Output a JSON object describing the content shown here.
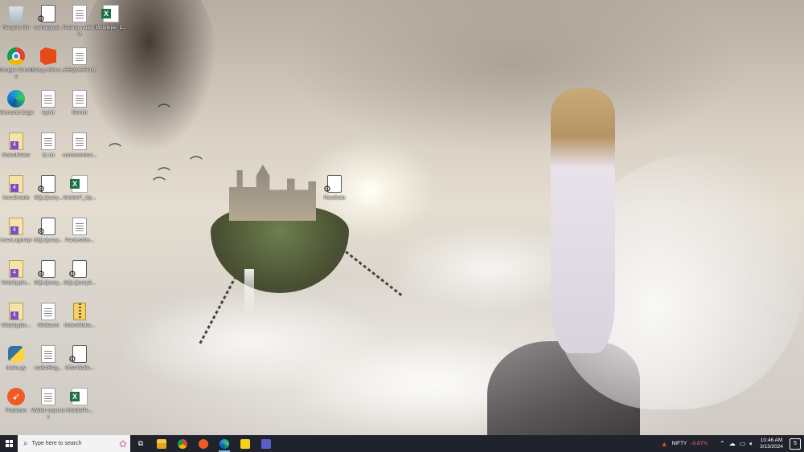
{
  "desktop": {
    "icons": [
      {
        "label": "Recycle Bin",
        "icon": "recycle-bin-icon"
      },
      {
        "label": "rechargepl...",
        "icon": "config-file-icon"
      },
      {
        "label": "Testing wallet.txt",
        "icon": "text-file-icon"
      },
      {
        "label": "Mobilepe_L...",
        "icon": "excel-file-icon"
      },
      {
        "label": "Google Chrome",
        "icon": "chrome-icon"
      },
      {
        "label": "Setup.X64.e...",
        "icon": "office-setup-icon"
      },
      {
        "label": "REQUEST.txt",
        "icon": "text-file-icon"
      },
      {
        "label": "Microsoft Edge",
        "icon": "edge-icon"
      },
      {
        "label": "ey.txt",
        "icon": "text-file-icon"
      },
      {
        "label": "Ref.txt",
        "icon": "text-file-icon"
      },
      {
        "label": "NotesMaker",
        "icon": "visual-studio-solution-icon"
      },
      {
        "label": "11.txt",
        "icon": "text-file-icon"
      },
      {
        "label": "commonmov...",
        "icon": "text-file-icon"
      },
      {
        "label": "UserDetails",
        "icon": "visual-studio-solution-icon"
      },
      {
        "label": "SQLQuery...",
        "icon": "sql-file-icon"
      },
      {
        "label": "MobileP_Up...",
        "icon": "excel-file-icon"
      },
      {
        "label": "UserLoginApi",
        "icon": "visual-studio-solution-icon"
      },
      {
        "label": "SQLQuery...",
        "icon": "sql-file-icon"
      },
      {
        "label": "PartListNo...",
        "icon": "text-file-icon"
      },
      {
        "label": "WebApplic...",
        "icon": "visual-studio-solution-icon"
      },
      {
        "label": "SQLQuery...",
        "icon": "sql-file-icon"
      },
      {
        "label": "SQLQuery5...",
        "icon": "sql-file-icon"
      },
      {
        "label": "WebApplic...",
        "icon": "visual-studio-solution-icon"
      },
      {
        "label": "Wallet.txt",
        "icon": "text-file-icon"
      },
      {
        "label": "NotesMake...",
        "icon": "zip-folder-icon"
      },
      {
        "label": "index.py",
        "icon": "python-file-icon"
      },
      {
        "label": "walletReg...",
        "icon": "text-file-icon"
      },
      {
        "label": "OfferWalle...",
        "icon": "sql-file-icon"
      },
      {
        "label": "Postman",
        "icon": "postman-icon"
      },
      {
        "label": "Wallet vnput.txt",
        "icon": "text-file-icon"
      },
      {
        "label": "MobilePe...",
        "icon": "excel-file-icon"
      },
      {
        "label": "RawData",
        "icon": "config-file-icon"
      }
    ]
  },
  "taskbar": {
    "search_placeholder": "Type here to search",
    "apps": [
      {
        "name": "task-view-icon"
      },
      {
        "name": "file-explorer-icon"
      },
      {
        "name": "chrome-taskbar-icon"
      },
      {
        "name": "postman-taskbar-icon"
      },
      {
        "name": "edge-taskbar-icon"
      },
      {
        "name": "sticky-notes-icon"
      },
      {
        "name": "teams-icon"
      }
    ],
    "ticker": {
      "name": "NIFTY",
      "change": "-0.87%"
    },
    "clock": {
      "time": "10:46 AM",
      "date": "3/13/2024"
    },
    "notification_count": "5"
  },
  "colors": {
    "taskbar_bg": "#20232c",
    "ticker_negative": "#ff6b6b",
    "excel_green": "#1e7145"
  }
}
